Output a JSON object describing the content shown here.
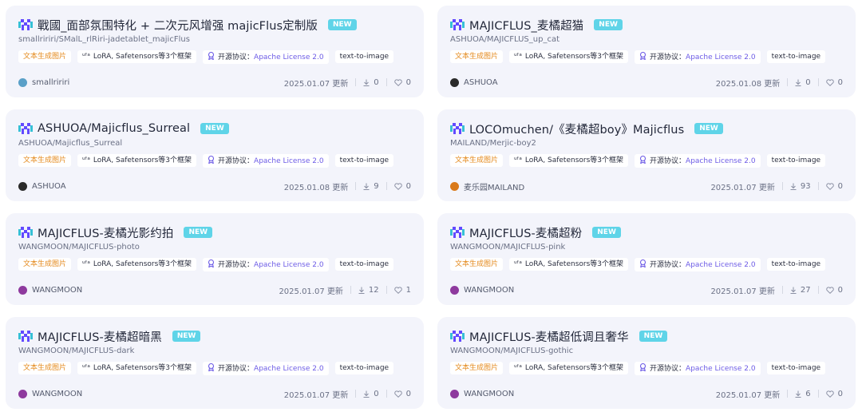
{
  "badge_label": "NEW",
  "updated_suffix": "更新",
  "cards": [
    {
      "title": "戰國_面部氛围特化 + 二次元风增强 majicFlus定制版",
      "repo": "smallririri/SMalL_rlRiri-jadetablet_majicFlus",
      "task_tag": "文本生成图片",
      "framework_tag": "LoRA, Safetensors等3个框架",
      "license_label": "开源协议：",
      "license_name": "Apache License 2.0",
      "pipeline_tag": "text-to-image",
      "owner": "smallririri",
      "avatar": "globe",
      "date": "2025.01.07",
      "downloads": "0",
      "likes": "0"
    },
    {
      "title": "MAJICFLUS_麦橘超猫",
      "repo": "ASHUOA/MAJICFLUS_up_cat",
      "task_tag": "文本生成图片",
      "framework_tag": "LoRA, Safetensors等3个框架",
      "license_label": "开源协议：",
      "license_name": "Apache License 2.0",
      "pipeline_tag": "text-to-image",
      "owner": "ASHUOA",
      "avatar": "dark",
      "date": "2025.01.08",
      "downloads": "0",
      "likes": "0"
    },
    {
      "title": "ASHUOA/Majicflus_Surreal",
      "repo": "ASHUOA/Majicflus_Surreal",
      "task_tag": "文本生成图片",
      "framework_tag": "LoRA, Safetensors等3个框架",
      "license_label": "开源协议：",
      "license_name": "Apache License 2.0",
      "pipeline_tag": "text-to-image",
      "owner": "ASHUOA",
      "avatar": "dark",
      "date": "2025.01.08",
      "downloads": "9",
      "likes": "0"
    },
    {
      "title": "LOCOmuchen/《麦橘超boy》Majicflus",
      "repo": "MAILAND/Merjic-boy2",
      "task_tag": "文本生成图片",
      "framework_tag": "LoRA, Safetensors等3个框架",
      "license_label": "开源协议：",
      "license_name": "Apache License 2.0",
      "pipeline_tag": "text-to-image",
      "owner": "麦乐园MAILAND",
      "avatar": "orange",
      "date": "2025.01.07",
      "downloads": "93",
      "likes": "0"
    },
    {
      "title": "MAJICFLUS-麦橘光影约拍",
      "repo": "WANGMOON/MAJICFLUS-photo",
      "task_tag": "文本生成图片",
      "framework_tag": "LoRA, Safetensors等3个框架",
      "license_label": "开源协议：",
      "license_name": "Apache License 2.0",
      "pipeline_tag": "text-to-image",
      "owner": "WANGMOON",
      "avatar": "purple",
      "date": "2025.01.07",
      "downloads": "12",
      "likes": "1"
    },
    {
      "title": "MAJICFLUS-麦橘超粉",
      "repo": "WANGMOON/MAJICFLUS-pink",
      "task_tag": "文本生成图片",
      "framework_tag": "LoRA, Safetensors等3个框架",
      "license_label": "开源协议：",
      "license_name": "Apache License 2.0",
      "pipeline_tag": "text-to-image",
      "owner": "WANGMOON",
      "avatar": "purple",
      "date": "2025.01.07",
      "downloads": "27",
      "likes": "0"
    },
    {
      "title": "MAJICFLUS-麦橘超暗黑",
      "repo": "WANGMOON/MAJICFLUS-dark",
      "task_tag": "文本生成图片",
      "framework_tag": "LoRA, Safetensors等3个框架",
      "license_label": "开源协议：",
      "license_name": "Apache License 2.0",
      "pipeline_tag": "text-to-image",
      "owner": "WANGMOON",
      "avatar": "purple",
      "date": "2025.01.07",
      "downloads": "0",
      "likes": "0"
    },
    {
      "title": "MAJICFLUS-麦橘超低调且奢华",
      "repo": "WANGMOON/MAJICFLUS-gothic",
      "task_tag": "文本生成图片",
      "framework_tag": "LoRA, Safetensors等3个框架",
      "license_label": "开源协议：",
      "license_name": "Apache License 2.0",
      "pipeline_tag": "text-to-image",
      "owner": "WANGMOON",
      "avatar": "purple",
      "date": "2025.01.07",
      "downloads": "6",
      "likes": "0"
    }
  ],
  "colors": {
    "card_bg": "#f3f4fb",
    "badge": "#5fd4e8",
    "task_tag": "#e48a1d",
    "license": "#6d5ce6",
    "avatar_globe": "#5aa0c8",
    "avatar_dark": "#2a2a2a",
    "avatar_orange": "#d9791a",
    "avatar_purple": "#8e3a9e"
  },
  "icons": {
    "model_logo": "modelscope-logo-icon",
    "framework": "framework-icon",
    "license": "license-award-icon",
    "downloads": "download-icon",
    "likes": "heart-icon"
  }
}
